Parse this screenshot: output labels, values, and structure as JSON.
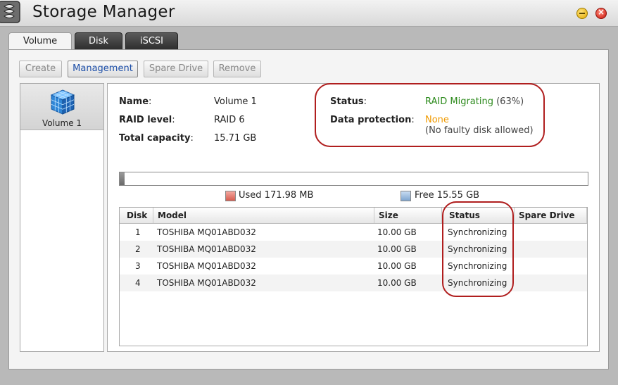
{
  "window": {
    "title": "Storage Manager"
  },
  "tabs": [
    {
      "label": "Volume",
      "active": true
    },
    {
      "label": "Disk",
      "active": false
    },
    {
      "label": "iSCSI",
      "active": false
    }
  ],
  "toolbar": {
    "create": "Create",
    "management": "Management",
    "spare_drive": "Spare Drive",
    "remove": "Remove"
  },
  "volumes": [
    {
      "label": "Volume 1",
      "selected": true
    }
  ],
  "details": {
    "name_label": "Name",
    "name_value": "Volume 1",
    "raid_label": "RAID level",
    "raid_value": "RAID 6",
    "capacity_label": "Total capacity",
    "capacity_value": "15.71 GB",
    "status_label": "Status",
    "status_value": "RAID Migrating",
    "status_percent": "(63%)",
    "protection_label": "Data protection",
    "protection_value": "None",
    "protection_note": "(No faulty disk allowed)"
  },
  "capacity": {
    "used_fraction": 0.011,
    "used_legend": "Used 171.98 MB",
    "free_legend": "Free 15.55 GB"
  },
  "disk_table": {
    "headers": {
      "disk": "Disk",
      "model": "Model",
      "size": "Size",
      "status": "Status",
      "spare": "Spare Drive"
    },
    "rows": [
      {
        "disk": "1",
        "model": "TOSHIBA MQ01ABD032",
        "size": "10.00 GB",
        "status": "Synchronizing",
        "spare": ""
      },
      {
        "disk": "2",
        "model": "TOSHIBA MQ01ABD032",
        "size": "10.00 GB",
        "status": "Synchronizing",
        "spare": ""
      },
      {
        "disk": "3",
        "model": "TOSHIBA MQ01ABD032",
        "size": "10.00 GB",
        "status": "Synchronizing",
        "spare": ""
      },
      {
        "disk": "4",
        "model": "TOSHIBA MQ01ABD032",
        "size": "10.00 GB",
        "status": "Synchronizing",
        "spare": ""
      }
    ]
  },
  "colors": {
    "status_green": "#2c8a1c",
    "protection_orange": "#f09a00",
    "highlight_ring": "#b01e1e",
    "link_blue": "#1d4fa8"
  }
}
